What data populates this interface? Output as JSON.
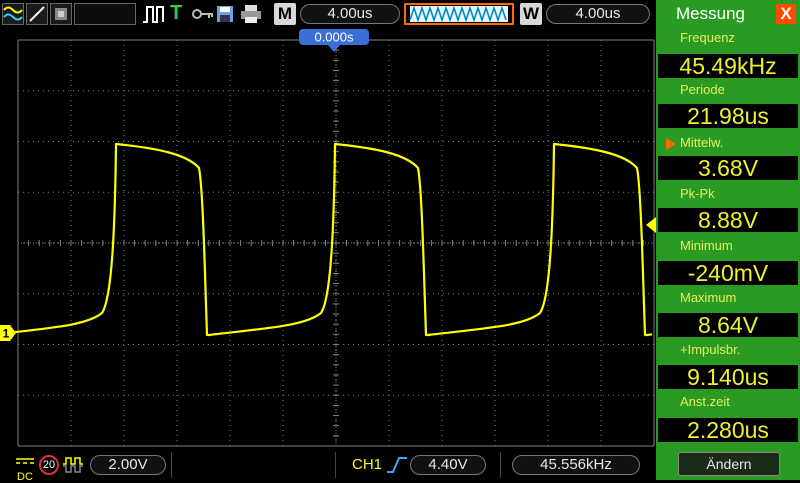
{
  "toolbar": {
    "mode_label": "M",
    "timebase": "4.00us",
    "window_label": "W",
    "window_timebase": "4.00us",
    "trigger_icon": "T"
  },
  "scope": {
    "trigger_offset": "0.000s",
    "channel_marker": "1",
    "vertical_divisions": 8,
    "horizontal_divisions": 12,
    "colors": {
      "trace": "#ffff00",
      "grid": "#808080",
      "background": "#000000"
    }
  },
  "bottom": {
    "coupling": "DC",
    "bw_limit": "20",
    "volts_div": "2.00V",
    "trigger_source": "CH1",
    "trigger_level": "4.40V",
    "trigger_freq": "45.556kHz"
  },
  "panel": {
    "title": "Messung",
    "close": "X",
    "button": "Ändern",
    "measurements": [
      {
        "label": "Frequenz",
        "value": "45.49kHz"
      },
      {
        "label": "Periode",
        "value": "21.98us"
      },
      {
        "label": "Mittelw.",
        "value": "3.68V"
      },
      {
        "label": "Pk-Pk",
        "value": "8.88V"
      },
      {
        "label": "Minimum",
        "value": "-240mV"
      },
      {
        "label": "Maximum",
        "value": "8.64V"
      },
      {
        "label": "+Impulsbr.",
        "value": "9.140us"
      },
      {
        "label": "Anst.zeit",
        "value": "2.280us"
      }
    ]
  }
}
